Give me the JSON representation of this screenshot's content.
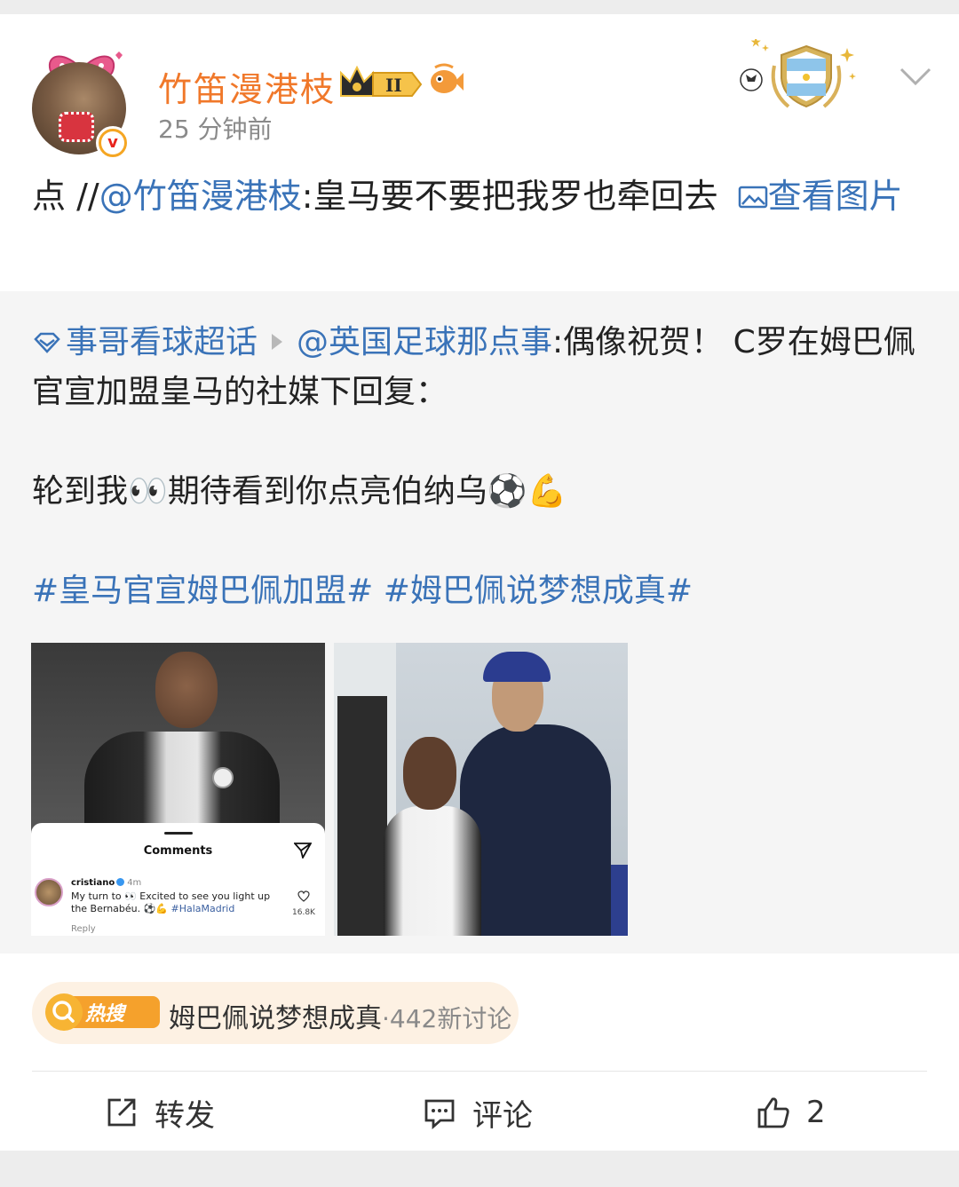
{
  "post": {
    "username": "竹笛漫港枝",
    "timestamp": "25 分钟前",
    "level_badge": "II",
    "verified_mark": "v",
    "repost": {
      "prefix": "点 //",
      "mention": "@竹笛漫港枝",
      "text": ":皇马要不要把我罗也牵回去 ",
      "view_image": "查看图片"
    }
  },
  "quoted": {
    "supertopic": "事哥看球超话",
    "author_mention": "@英国足球那点事",
    "text1": ":偶像祝贺！ C罗在姆巴佩官宣加盟皇马的社媒下回复：",
    "text2": "轮到我👀期待看到你点亮伯纳乌⚽️💪",
    "hashtags": "#皇马官宣姆巴佩加盟# #姆巴佩说梦想成真#",
    "images": {
      "comment_panel": {
        "title": "Comments",
        "user": "cristiano",
        "time": "4m",
        "comment_prefix": "My turn to 👀 Excited to see you light up the Bernabéu. ⚽️💪 ",
        "comment_tag": "#HalaMadrid",
        "reply": "Reply",
        "likes": "16.8K"
      }
    }
  },
  "hot_search": {
    "badge": "热搜",
    "topic": "姆巴佩说梦想成真",
    "count": "·442新讨论"
  },
  "actions": {
    "repost": "转发",
    "comment": "评论",
    "like_count": "2"
  },
  "colors": {
    "link": "#3a73b8",
    "username": "#f0782a",
    "hot_bg": "#fdf1e3"
  },
  "icons": [
    "avatar",
    "crown-badge-icon",
    "fish-icon",
    "argentina-emblem-icon",
    "chevron-down-icon",
    "image-icon",
    "supertopic-icon",
    "repost-icon",
    "comment-icon",
    "like-icon"
  ]
}
